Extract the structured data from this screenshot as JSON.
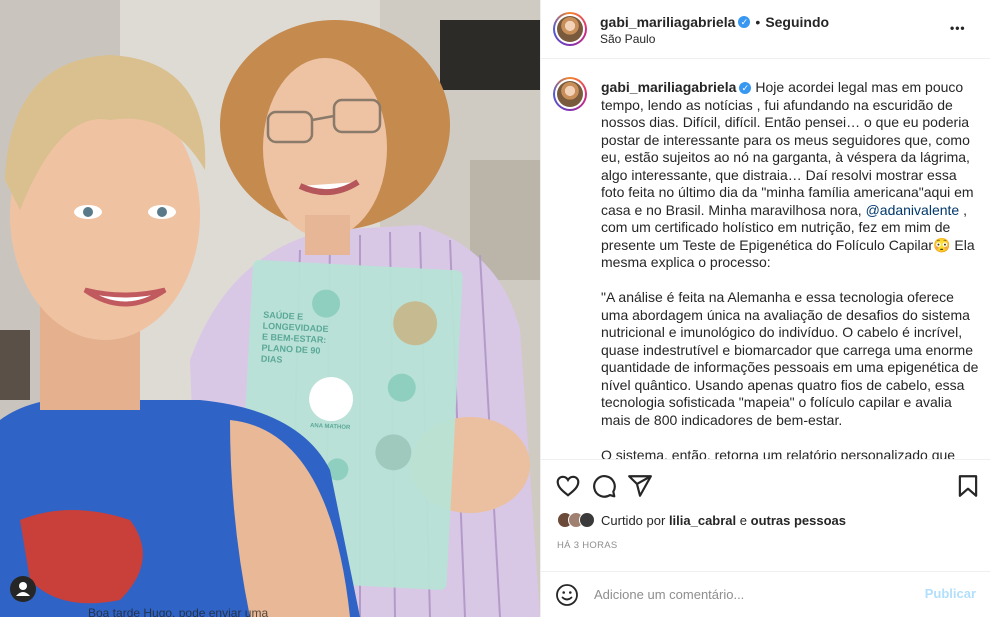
{
  "post": {
    "username": "gabi_mariliagabriela",
    "follow_status": "Seguindo",
    "location": "São Paulo",
    "more_label": "•••",
    "verified_badge": "✓"
  },
  "photo": {
    "overlay_text": "Boa tarde Hugo, pode enviar uma",
    "booklet_brand": "ANA MATHOR",
    "booklet_lines": [
      "SAÚDE E",
      "LONGEVIDADE",
      "E BEM-ESTAR:",
      "PLANO DE 90",
      "DIAS"
    ]
  },
  "caption": {
    "paragraph1_start": "Hoje acordei legal mas em pouco tempo, lendo as notícias , fui afundando na escuridão de nossos dias. Difícil, difícil. Então pensei… o que eu poderia postar de interessante para os meus seguidores que, como eu, estão sujeitos ao nó na garganta, à véspera da lágrima, algo interessante, que distraia… Daí resolvi mostrar essa foto feita no último dia da \"minha família americana\"aqui em casa e no Brasil. Minha maravilhosa nora, ",
    "mention": "@adanivalente",
    "paragraph1_end": " , com um certificado holístico em nutrição, fez em mim de presente um Teste de Epigenética do Folículo Capilar😳 Ela mesma explica o processo:",
    "paragraph2": "\"A análise é feita na Alemanha e essa tecnologia oferece uma abordagem única na avaliação de desafios do sistema nutricional e imunológico do indivíduo. O cabelo é incrível, quase indestrutível e biomarcador que carrega uma enorme quantidade de informações pessoais em uma epigenética de nível quântico. Usando apenas quatro fios de cabelo, essa tecnologia sofisticada \"mapeia\" o folículo capilar e avalia mais de 800 indicadores de bem-estar.",
    "paragraph3": "O sistema, então, retorna um relatório personalizado que identifica os aspectos nutricionais e influências ambientais para o indivíduo. Esses dados são usados para criar os gráficos e tabelas que compõem o relatório completo e um plano de nutrição de 90 dias.\""
  },
  "likes": {
    "prefix": "Curtido por",
    "user": "lilia_cabral",
    "connector": "e",
    "others": "outras pessoas"
  },
  "timestamp": "HÁ 3 HORAS",
  "comment": {
    "placeholder": "Adicione um comentário...",
    "publish_label": "Publicar"
  },
  "colors": {
    "accent": "#0095f6",
    "publish_disabled": "#b2dffc",
    "verified": "#3897f0",
    "text": "#262626",
    "muted": "#8e8e8e"
  }
}
